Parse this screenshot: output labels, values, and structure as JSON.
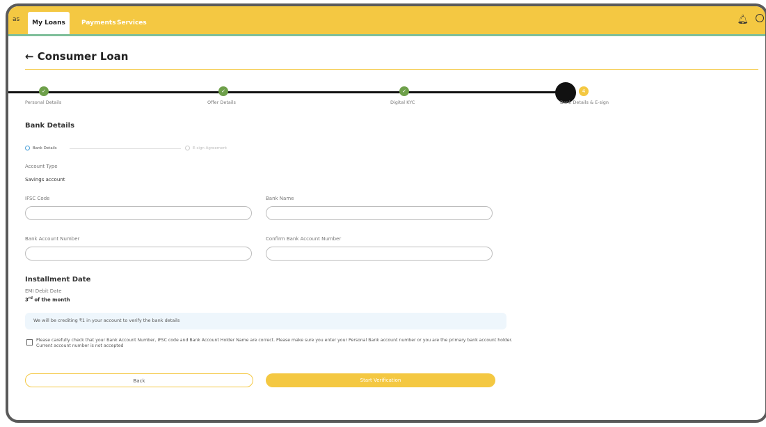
{
  "nav": {
    "edge_text": "as",
    "tabs": [
      "My Loans",
      "Payments",
      "Services"
    ]
  },
  "page": {
    "title": "← Consumer Loan"
  },
  "stepper": {
    "steps": [
      {
        "label": "Personal Details",
        "mark": "✓",
        "status": "complete"
      },
      {
        "label": "Offer Details",
        "mark": "✓",
        "status": "complete"
      },
      {
        "label": "Digital KYC",
        "mark": "✓",
        "status": "complete"
      },
      {
        "label": "Bank Details & E-sign",
        "mark": "4",
        "status": "current"
      }
    ]
  },
  "bank": {
    "section_title": "Bank Details",
    "substeps": [
      "Bank Details",
      "E-sign Agreement"
    ],
    "account_type_label": "Account Type",
    "account_type_value": "Savings account",
    "ifsc_label": "IFSC Code",
    "bank_name_label": "Bank Name",
    "account_number_label": "Bank Account Number",
    "confirm_account_label": "Confirm Bank Account Number"
  },
  "installment": {
    "title": "Installment Date",
    "emi_label": "EMI Debit Date",
    "emi_value_day": "3",
    "emi_value_suffix": "rd",
    "emi_value_rest": " of the month"
  },
  "info": {
    "text": "We will be crediting ₹1 in your account to verify the bank details"
  },
  "consent": {
    "text": "Please carefully check that your Bank Account Number, IFSC code and Bank Account Holder Name are correct. Please make sure you enter your Personal Bank account number or you are the primary bank account holder. Current account number is not accepted"
  },
  "buttons": {
    "back": "Back",
    "start": "Start Verification"
  },
  "colors": {
    "accent": "#f4c842",
    "complete": "#6ea04a",
    "info_bg": "#eef6fc"
  }
}
